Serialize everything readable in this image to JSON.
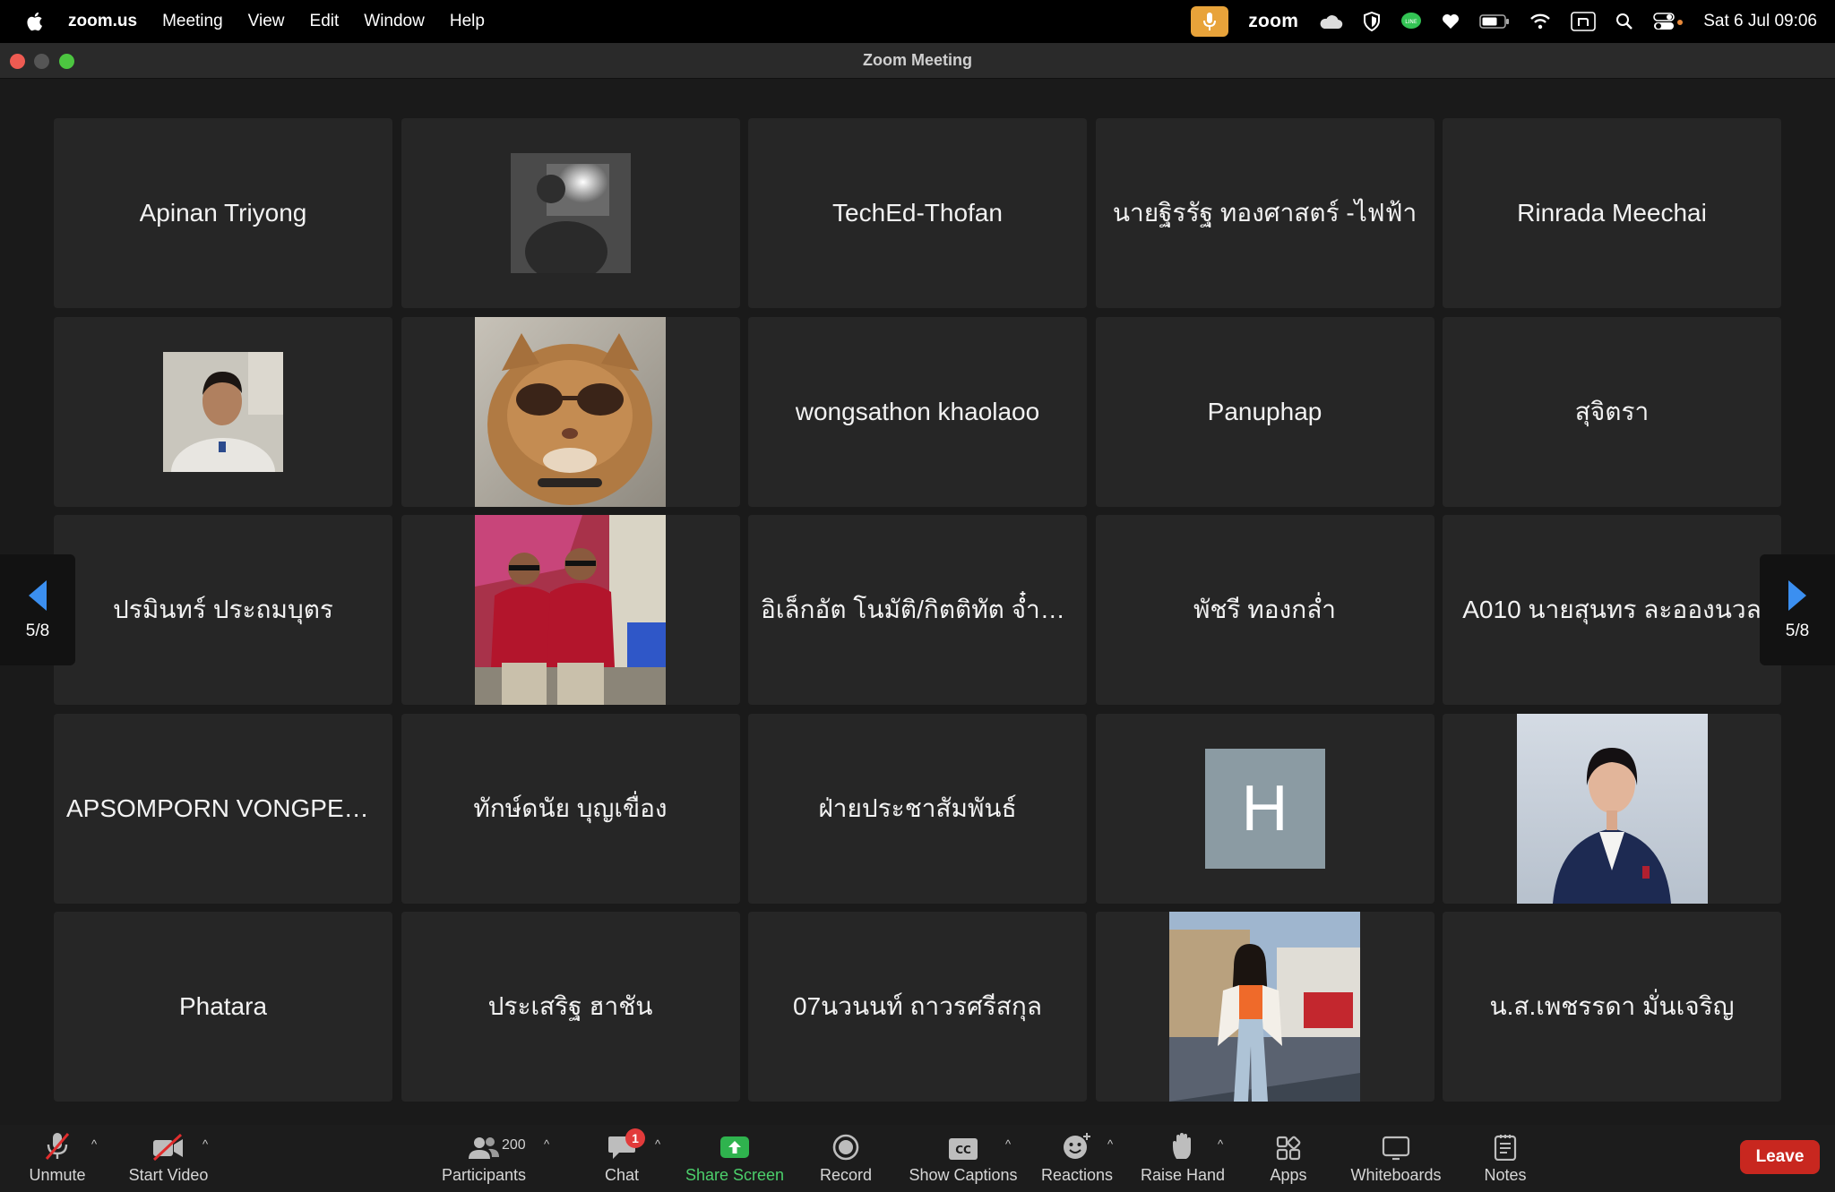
{
  "menubar": {
    "app_name": "zoom.us",
    "items": [
      "Meeting",
      "View",
      "Edit",
      "Window",
      "Help"
    ],
    "status_app_name": "zoom",
    "clock": "Sat 6 Jul  09:06",
    "status_icons": [
      "mic-icon",
      "cloud-icon",
      "shield-icon",
      "line-icon",
      "heart-icon",
      "battery-icon",
      "wifi-icon",
      "input-source-icon",
      "search-icon",
      "control-center-icon"
    ]
  },
  "window": {
    "title": "Zoom Meeting"
  },
  "gallery": {
    "tiles": [
      {
        "name": "Apinan Triyong"
      },
      {
        "name": "",
        "avatar": "camera-video"
      },
      {
        "name": "TechEd-Thofan"
      },
      {
        "name": "นายฐิรรัฐ ทองศาสตร์ -ไฟฟ้า"
      },
      {
        "name": "Rinrada Meechai"
      },
      {
        "name": "",
        "avatar": "profile-photo"
      },
      {
        "name": "",
        "avatar": "cat-photo"
      },
      {
        "name": "wongsathon khaolaoo"
      },
      {
        "name": "Panuphap"
      },
      {
        "name": "สุจิตรา"
      },
      {
        "name": "ปรมินทร์ ประถมบุตร"
      },
      {
        "name": "",
        "avatar": "group-photo"
      },
      {
        "name": "อิเล็กอัต โนมัติ/กิตติทัต จ๋ำป..."
      },
      {
        "name": "พัชรี ทองกล่ำ"
      },
      {
        "name": "A010 นายสุนทร ละอองนวล"
      },
      {
        "name": "APSOMPORN VONGPEA..."
      },
      {
        "name": "ทักษ์ดนัย บุญเขื่อง"
      },
      {
        "name": "ฝ่ายประชาสัมพันธ์"
      },
      {
        "name": "",
        "avatar": "letter",
        "letter": "H"
      },
      {
        "name": "",
        "avatar": "portrait-photo"
      },
      {
        "name": "Phatara"
      },
      {
        "name": "ประเสริฐ ฮาชัน"
      },
      {
        "name": "07นวนนท์ ถาวรศรีสกุล"
      },
      {
        "name": "",
        "avatar": "street-photo"
      },
      {
        "name": "น.ส.เพชรรดา มั่นเจริญ"
      }
    ]
  },
  "pager": {
    "current_page": 5,
    "total_pages": 8,
    "label": "5/8"
  },
  "toolbar": {
    "unmute_label": "Unmute",
    "start_video_label": "Start Video",
    "participants_label": "Participants",
    "participants_count": "200",
    "chat_label": "Chat",
    "chat_unread": "1",
    "share_label": "Share Screen",
    "record_label": "Record",
    "captions_label": "Show Captions",
    "reactions_label": "Reactions",
    "raise_hand_label": "Raise Hand",
    "apps_label": "Apps",
    "whiteboards_label": "Whiteboards",
    "notes_label": "Notes",
    "leave_label": "Leave"
  },
  "colors": {
    "share_green": "#4ccf6b",
    "leave_red": "#c8271f",
    "pager_arrow_blue": "#3b8ff0",
    "mic_pill_orange": "#e8a33a"
  }
}
